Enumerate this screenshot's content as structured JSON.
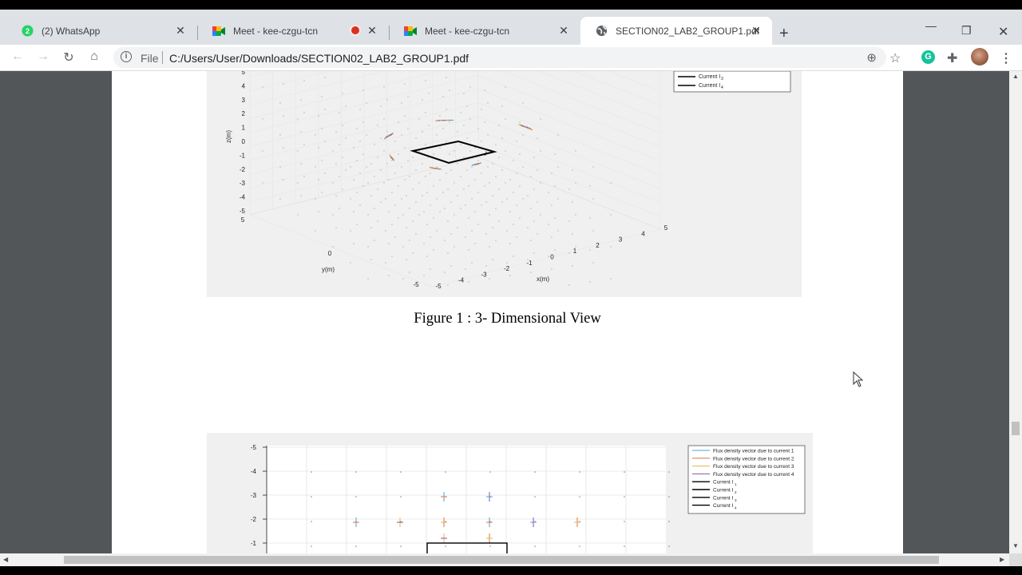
{
  "browser": {
    "tabs": [
      {
        "title": "(2) WhatsApp",
        "icon": "whatsapp-icon"
      },
      {
        "title": "Meet - kee-czgu-tcn",
        "icon": "google-meet-icon",
        "recording": true
      },
      {
        "title": "Meet - kee-czgu-tcn",
        "icon": "google-meet-icon"
      },
      {
        "title": "SECTION02_LAB2_GROUP1.pdf",
        "icon": "globe-icon",
        "active": true
      }
    ],
    "address": {
      "scheme_label": "File",
      "url": "C:/Users/User/Downloads/SECTION02_LAB2_GROUP1.pdf"
    },
    "grammarly_letter": "G"
  },
  "document": {
    "figure1": {
      "legend": [
        "Current I",
        "Current I"
      ],
      "legend_subscripts": [
        "3",
        "4"
      ],
      "z_axis_label": "z(m)",
      "z_ticks": [
        "5",
        "4",
        "3",
        "2",
        "1",
        "0",
        "-1",
        "-2",
        "-3",
        "-4",
        "-5"
      ],
      "y_axis_label": "y(m)",
      "y_ticks": [
        "5",
        "0",
        "-5"
      ],
      "x_axis_label": "x(m)",
      "x_ticks": [
        "-5",
        "-4",
        "-3",
        "-2",
        "-1",
        "0",
        "1",
        "2",
        "3",
        "4",
        "5"
      ]
    },
    "caption1": "Figure 1 : 3- Dimensional View",
    "figure2": {
      "y_ticks": [
        "-5",
        "-4",
        "-3",
        "-2",
        "-1"
      ],
      "legend": [
        "Flux density vector due to current 1",
        "Flux density vector due to current 2",
        "Flux density vector due to current 3",
        "Flux density vector due to current 4",
        "Current I",
        "Current I",
        "Current I",
        "Current I"
      ],
      "legend_subscripts": [
        "1",
        "2",
        "3",
        "4"
      ],
      "series_colors": [
        "#4ea0d8",
        "#d9763c",
        "#e8b64a",
        "#8a52a8",
        "#000000"
      ]
    }
  }
}
